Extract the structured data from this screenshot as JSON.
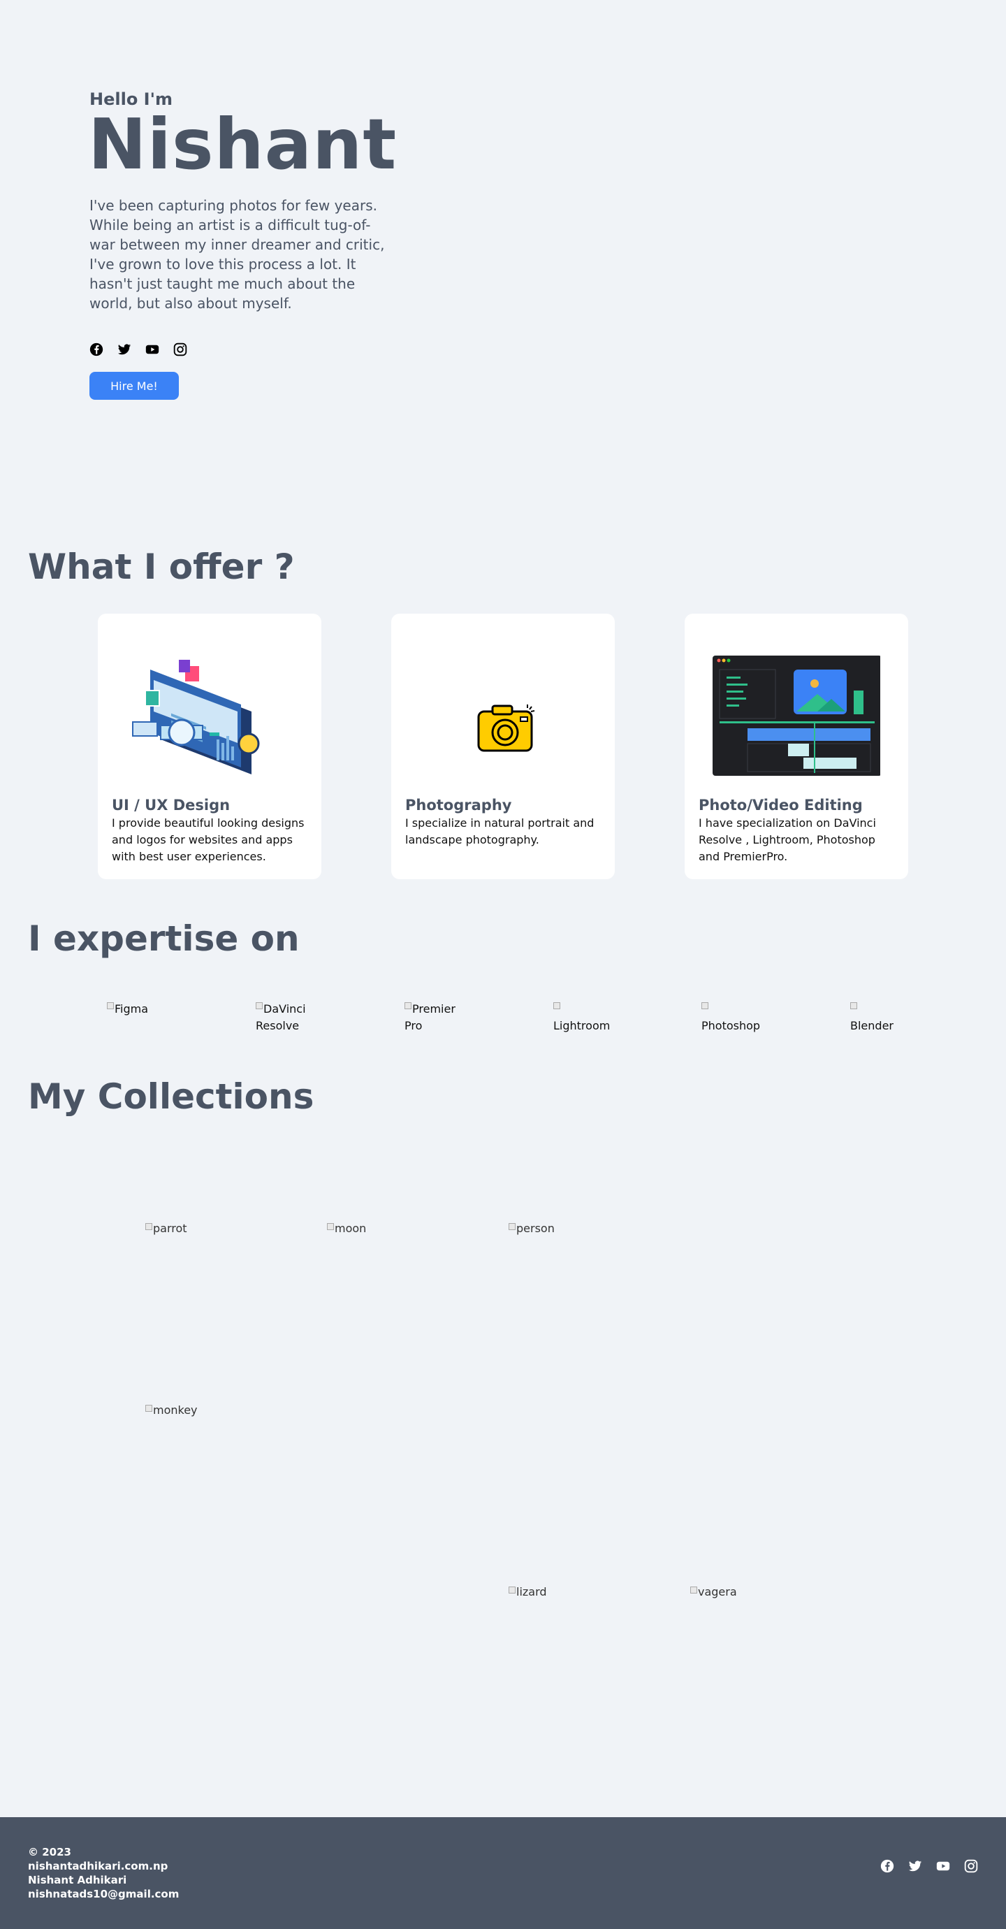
{
  "hero": {
    "greeting": "Hello I'm",
    "name": "Nishant",
    "bio": "I've been capturing photos for few years. While being an artist is a difficult tug-of-war between my inner dreamer and critic, I've grown to love this process a lot. It hasn't just taught me much about the world, but also about myself.",
    "socials": [
      "facebook-icon",
      "twitter-icon",
      "youtube-icon",
      "instagram-icon"
    ],
    "hire_label": "Hire Me!"
  },
  "offer": {
    "title": "What I offer ?",
    "cards": [
      {
        "title": "UI / UX Design",
        "desc": "I provide beautiful looking designs and logos for websites and apps with best user experiences.",
        "icon": "ui-ux-illustration"
      },
      {
        "title": "Photography",
        "desc": "I specialize in natural portrait and landscape photography.",
        "icon": "camera-icon"
      },
      {
        "title": "Photo/Video Editing",
        "desc": "I have specialization on DaVinci Resolve , Lightroom, Photoshop and PremierPro.",
        "icon": "editor-illustration"
      }
    ]
  },
  "expertise": {
    "title": "I expertise on",
    "skills": [
      "Figma",
      "DaVinci Resolve",
      "Premier Pro",
      "Lightroom",
      "Photoshop",
      "Blender"
    ]
  },
  "collections": {
    "title": "My Collections",
    "photos": [
      "parrot",
      "moon",
      "person",
      "monkey",
      "lizard",
      "vagera"
    ]
  },
  "footer": {
    "copyright": "© 2023",
    "domain": "nishantadhikari.com.np",
    "owner": "Nishant Adhikari",
    "email": "nishnatads10@gmail.com"
  },
  "colors": {
    "background": "#f0f3f7",
    "text": "#4a5464",
    "accent": "#3b82f6",
    "footer": "#4a5464"
  }
}
